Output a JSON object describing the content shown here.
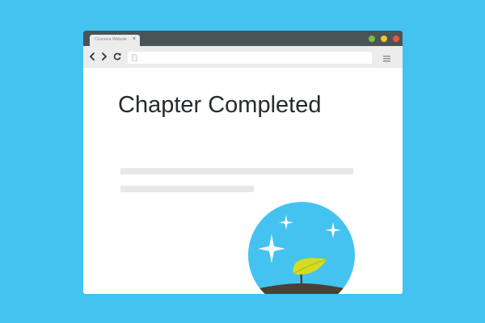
{
  "browser": {
    "tab": {
      "title": "Coursera Website",
      "close_glyph": "×"
    },
    "window_controls": [
      {
        "name": "maximize",
        "color": "#78c043"
      },
      {
        "name": "minimize",
        "color": "#f1c530"
      },
      {
        "name": "close",
        "color": "#e9573f"
      }
    ],
    "toolbar": {
      "back_icon": "chevron-left-icon",
      "forward_icon": "chevron-right-icon",
      "reload_icon": "reload-icon",
      "address_value": "",
      "page_icon": "page-icon",
      "menu_icon": "hamburger-menu-icon"
    }
  },
  "page": {
    "heading": "Chapter Completed",
    "badge_icon": "sprout-icon"
  },
  "colors": {
    "background": "#44c3f1",
    "titlebar": "#4a5457",
    "toolbar": "#ececec",
    "heading": "#262b2e",
    "placeholder_line": "#e8e8e8",
    "badge_sky": "#44c3f1",
    "badge_ground": "#4d3f37",
    "leaf": "#d4dc21"
  }
}
